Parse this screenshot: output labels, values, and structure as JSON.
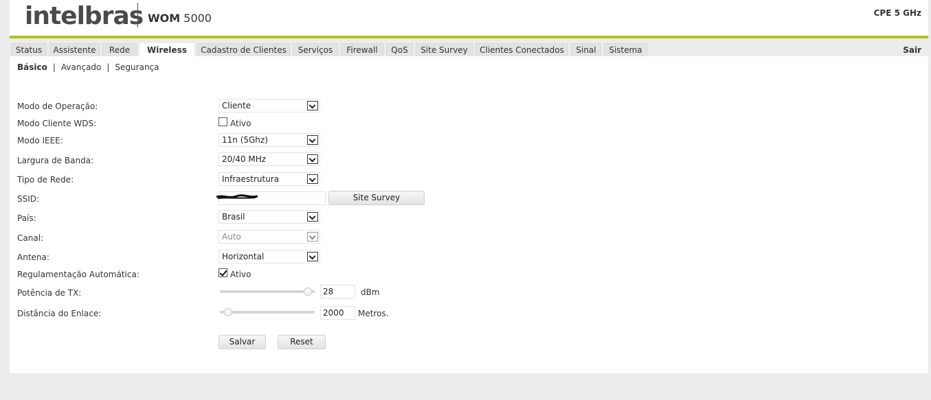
{
  "header": {
    "logo": "intelbras",
    "product_prefix": "WOM",
    "product_number": "5000",
    "device_label": "CPE 5 GHz",
    "accent_color": "#b1c220"
  },
  "tabs": [
    {
      "label": "Status"
    },
    {
      "label": "Assistente"
    },
    {
      "label": "Rede"
    },
    {
      "label": "Wireless",
      "active": true
    },
    {
      "label": "Cadastro de Clientes"
    },
    {
      "label": "Serviços"
    },
    {
      "label": "Firewall"
    },
    {
      "label": "QoS"
    },
    {
      "label": "Site Survey"
    },
    {
      "label": "Clientes Conectados"
    },
    {
      "label": "Sinal"
    },
    {
      "label": "Sistema"
    }
  ],
  "logout_label": "Sair",
  "subnav": {
    "basic": "Básico",
    "advanced": "Avançado",
    "security": "Segurança",
    "separator": "|"
  },
  "form": {
    "operation_mode": {
      "label": "Modo de Operação:",
      "value": "Cliente"
    },
    "wds_client_mode": {
      "label": "Modo Cliente WDS:",
      "checkbox_label": "Ativo",
      "checked": false
    },
    "ieee_mode": {
      "label": "Modo IEEE:",
      "value": "11n (5Ghz)"
    },
    "bandwidth": {
      "label": "Largura de Banda:",
      "value": "20/40 MHz"
    },
    "network_type": {
      "label": "Tipo de Rede:",
      "value": "Infraestrutura"
    },
    "ssid": {
      "label": "SSID:",
      "value": "",
      "button": "Site Survey"
    },
    "country": {
      "label": "País:",
      "value": "Brasil"
    },
    "channel": {
      "label": "Canal:",
      "value": "Auto",
      "disabled": true
    },
    "antenna": {
      "label": "Antena:",
      "value": "Horizontal"
    },
    "auto_regulation": {
      "label": "Regulamentação Automática:",
      "checkbox_label": "Ativo",
      "checked": true
    },
    "tx_power": {
      "label": "Potência de TX:",
      "value": "28",
      "unit": "dBm",
      "slider_level": 0.97
    },
    "link_distance": {
      "label": "Distância do Enlace:",
      "value": "2000",
      "unit": "Metros.",
      "slider_level": 0.05
    }
  },
  "actions": {
    "save": "Salvar",
    "reset": "Reset"
  }
}
